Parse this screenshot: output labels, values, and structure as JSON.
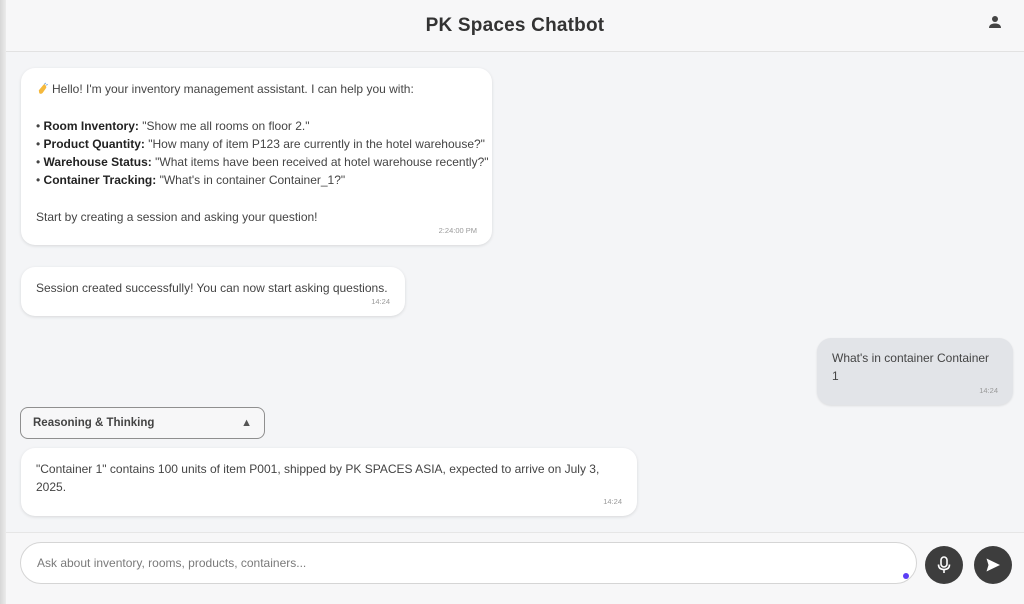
{
  "header": {
    "title": "PK Spaces Chatbot",
    "user_icon": "user-icon"
  },
  "messages": {
    "welcome": {
      "wave_icon": "waving-hand-icon",
      "intro": "Hello! I'm your inventory management assistant. I can help you with:",
      "items": [
        {
          "label": "Room Inventory:",
          "text": "\"Show me all rooms on floor 2.\""
        },
        {
          "label": "Product Quantity:",
          "text": "\"How many of item P123 are currently in the hotel warehouse?\""
        },
        {
          "label": "Warehouse Status:",
          "text": "\"What items have been received at hotel warehouse recently?\""
        },
        {
          "label": "Container Tracking:",
          "text": "\"What's in container Container_1?\""
        }
      ],
      "outro": "Start by creating a session and asking your question!",
      "time": "2:24:00 PM"
    },
    "session": {
      "text": "Session created successfully! You can now start asking questions.",
      "time": "14:24"
    },
    "user_query": {
      "text": "What's in container Container 1",
      "time": "14:24"
    },
    "reasoning": {
      "label": "Reasoning & Thinking",
      "arrow": "▲"
    },
    "answer": {
      "text": "\"Container 1\" contains 100 units of item P001, shipped by PK SPACES ASIA, expected to arrive on July 3, 2025.",
      "time": "14:24"
    }
  },
  "input": {
    "placeholder": "Ask about inventory, rooms, products, containers...",
    "value": ""
  },
  "buttons": {
    "mic_icon": "microphone-icon",
    "send_icon": "send-icon"
  },
  "colors": {
    "accent_dot": "#5b3df5",
    "button_bg": "#3d3d3d",
    "user_bubble": "#e2e4e8"
  }
}
